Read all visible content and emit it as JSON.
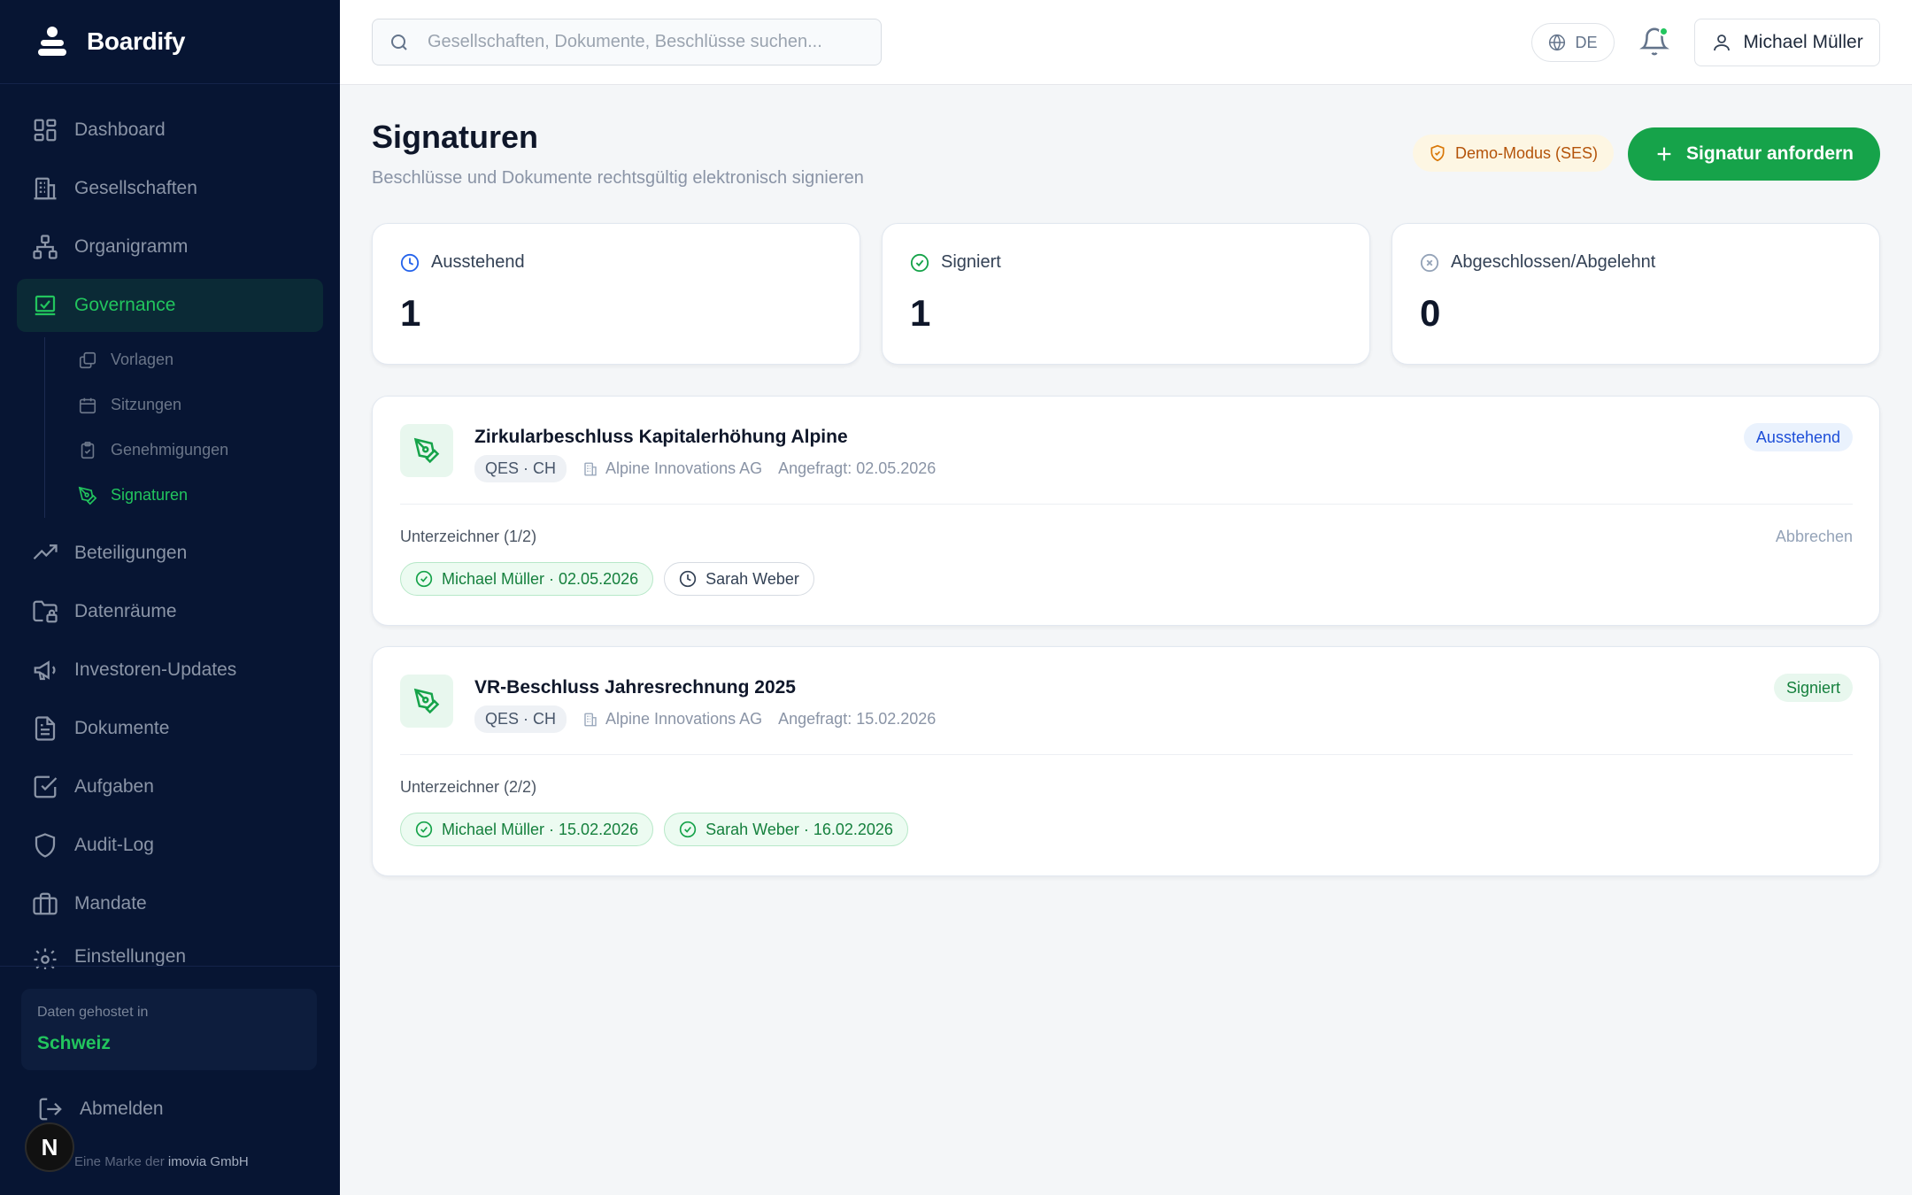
{
  "app": {
    "name": "Boardify"
  },
  "sidebar": {
    "items": [
      {
        "label": "Dashboard",
        "icon": "dashboard-icon"
      },
      {
        "label": "Gesellschaften",
        "icon": "building-icon"
      },
      {
        "label": "Organigramm",
        "icon": "org-chart-icon"
      },
      {
        "label": "Governance",
        "icon": "governance-icon",
        "active": true
      },
      {
        "label": "Beteiligungen",
        "icon": "trending-up-icon"
      },
      {
        "label": "Datenräume",
        "icon": "folder-lock-icon"
      },
      {
        "label": "Investoren-Updates",
        "icon": "megaphone-icon"
      },
      {
        "label": "Dokumente",
        "icon": "document-icon"
      },
      {
        "label": "Aufgaben",
        "icon": "checkbox-icon"
      },
      {
        "label": "Audit-Log",
        "icon": "shield-icon"
      },
      {
        "label": "Mandate",
        "icon": "briefcase-icon"
      },
      {
        "label": "Einstellungen",
        "icon": "gear-icon"
      }
    ],
    "subitems": [
      {
        "label": "Vorlagen",
        "icon": "copy-icon"
      },
      {
        "label": "Sitzungen",
        "icon": "calendar-icon"
      },
      {
        "label": "Genehmigungen",
        "icon": "clipboard-check-icon"
      },
      {
        "label": "Signaturen",
        "icon": "pen-icon",
        "active": true
      }
    ],
    "hosting_label": "Daten gehostet in",
    "hosting_value": "Schweiz",
    "logout": "Abmelden",
    "brand_note_prefix": "Eine Marke der",
    "brand_note_company": "imovia GmbH",
    "badge_letter": "N"
  },
  "topbar": {
    "search_placeholder": "Gesellschaften, Dokumente, Beschlüsse suchen...",
    "language": "DE",
    "user_name": "Michael Müller"
  },
  "page": {
    "title": "Signaturen",
    "subtitle": "Beschlüsse und Dokumente rechtsgültig elektronisch signieren",
    "demo_badge": "Demo-Modus (SES)",
    "primary_action": "Signatur anfordern"
  },
  "stats": [
    {
      "label": "Ausstehend",
      "value": "1",
      "color": "#2563eb"
    },
    {
      "label": "Signiert",
      "value": "1",
      "color": "#16a34a"
    },
    {
      "label": "Abgeschlossen/Abgelehnt",
      "value": "0",
      "color": "#94a3b8"
    }
  ],
  "requests": [
    {
      "title": "Zirkularbeschluss Kapitalerhöhung Alpine",
      "tag": "QES · CH",
      "company": "Alpine Innovations AG",
      "requested": "Angefragt: 02.05.2026",
      "status": "Ausstehend",
      "signers_label": "Unterzeichner (1/2)",
      "cancel": "Abbrechen",
      "signers": [
        {
          "text": "Michael Müller · 02.05.2026",
          "state": "signed"
        },
        {
          "text": "Sarah Weber",
          "state": "pending"
        }
      ]
    },
    {
      "title": "VR-Beschluss Jahresrechnung 2025",
      "tag": "QES · CH",
      "company": "Alpine Innovations AG",
      "requested": "Angefragt: 15.02.2026",
      "status": "Signiert",
      "signers_label": "Unterzeichner (2/2)",
      "signers": [
        {
          "text": "Michael Müller · 15.02.2026",
          "state": "signed"
        },
        {
          "text": "Sarah Weber · 16.02.2026",
          "state": "signed"
        }
      ]
    }
  ],
  "colors": {
    "accent": "#16a34a",
    "sidebar_bg": "#071533",
    "active_nav_bg": "#0b2a36"
  }
}
